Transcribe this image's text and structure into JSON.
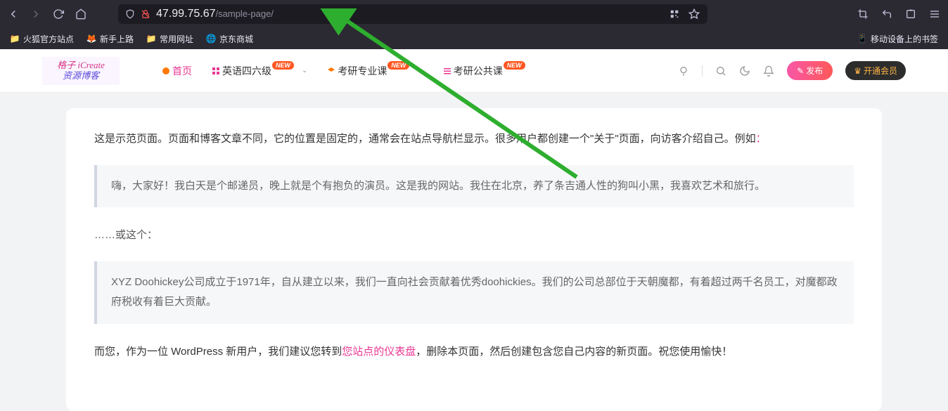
{
  "browser": {
    "url_host": "47.99.75.67",
    "url_path": "/sample-page/"
  },
  "bookmarks": {
    "b1": "火狐官方站点",
    "b2": "新手上路",
    "b3": "常用网址",
    "b4": "京东商城",
    "mobile": "移动设备上的书签"
  },
  "logo": {
    "line1": "格子 iCreate",
    "line2": "资源博客"
  },
  "nav": {
    "home": "首页",
    "english": "英语四六级",
    "kaoyan_pro": "考研专业课",
    "kaoyan_pub": "考研公共课",
    "new_badge": "NEW"
  },
  "header_right": {
    "publish": "发布",
    "member": "开通会员"
  },
  "content": {
    "p1_a": "这是示范页面。页面和博客文章不同，它的位置是固定的，通常会在站点导航栏显示。很多用户都创建一个\"关于\"页面，向访客介绍自己。例如",
    "p1_colon": "：",
    "q1": "嗨，大家好！我白天是个邮递员，晚上就是个有抱负的演员。这是我的网站。我住在北京，养了条吉通人性的狗叫小黑，我喜欢艺术和旅行。",
    "p2": "……或这个：",
    "q2": "XYZ Doohickey公司成立于1971年，自从建立以来，我们一直向社会贡献着优秀doohickies。我们的公司总部位于天朝魔都，有着超过两千名员工，对魔都政府税收有着巨大贡献。",
    "p3_a": "而您，作为一位 WordPress 新用户，我们建议您转到",
    "p3_link": "您站点的仪表盘",
    "p3_b": "，删除本页面，然后创建包含您自己内容的新页面。祝您使用愉快！"
  }
}
